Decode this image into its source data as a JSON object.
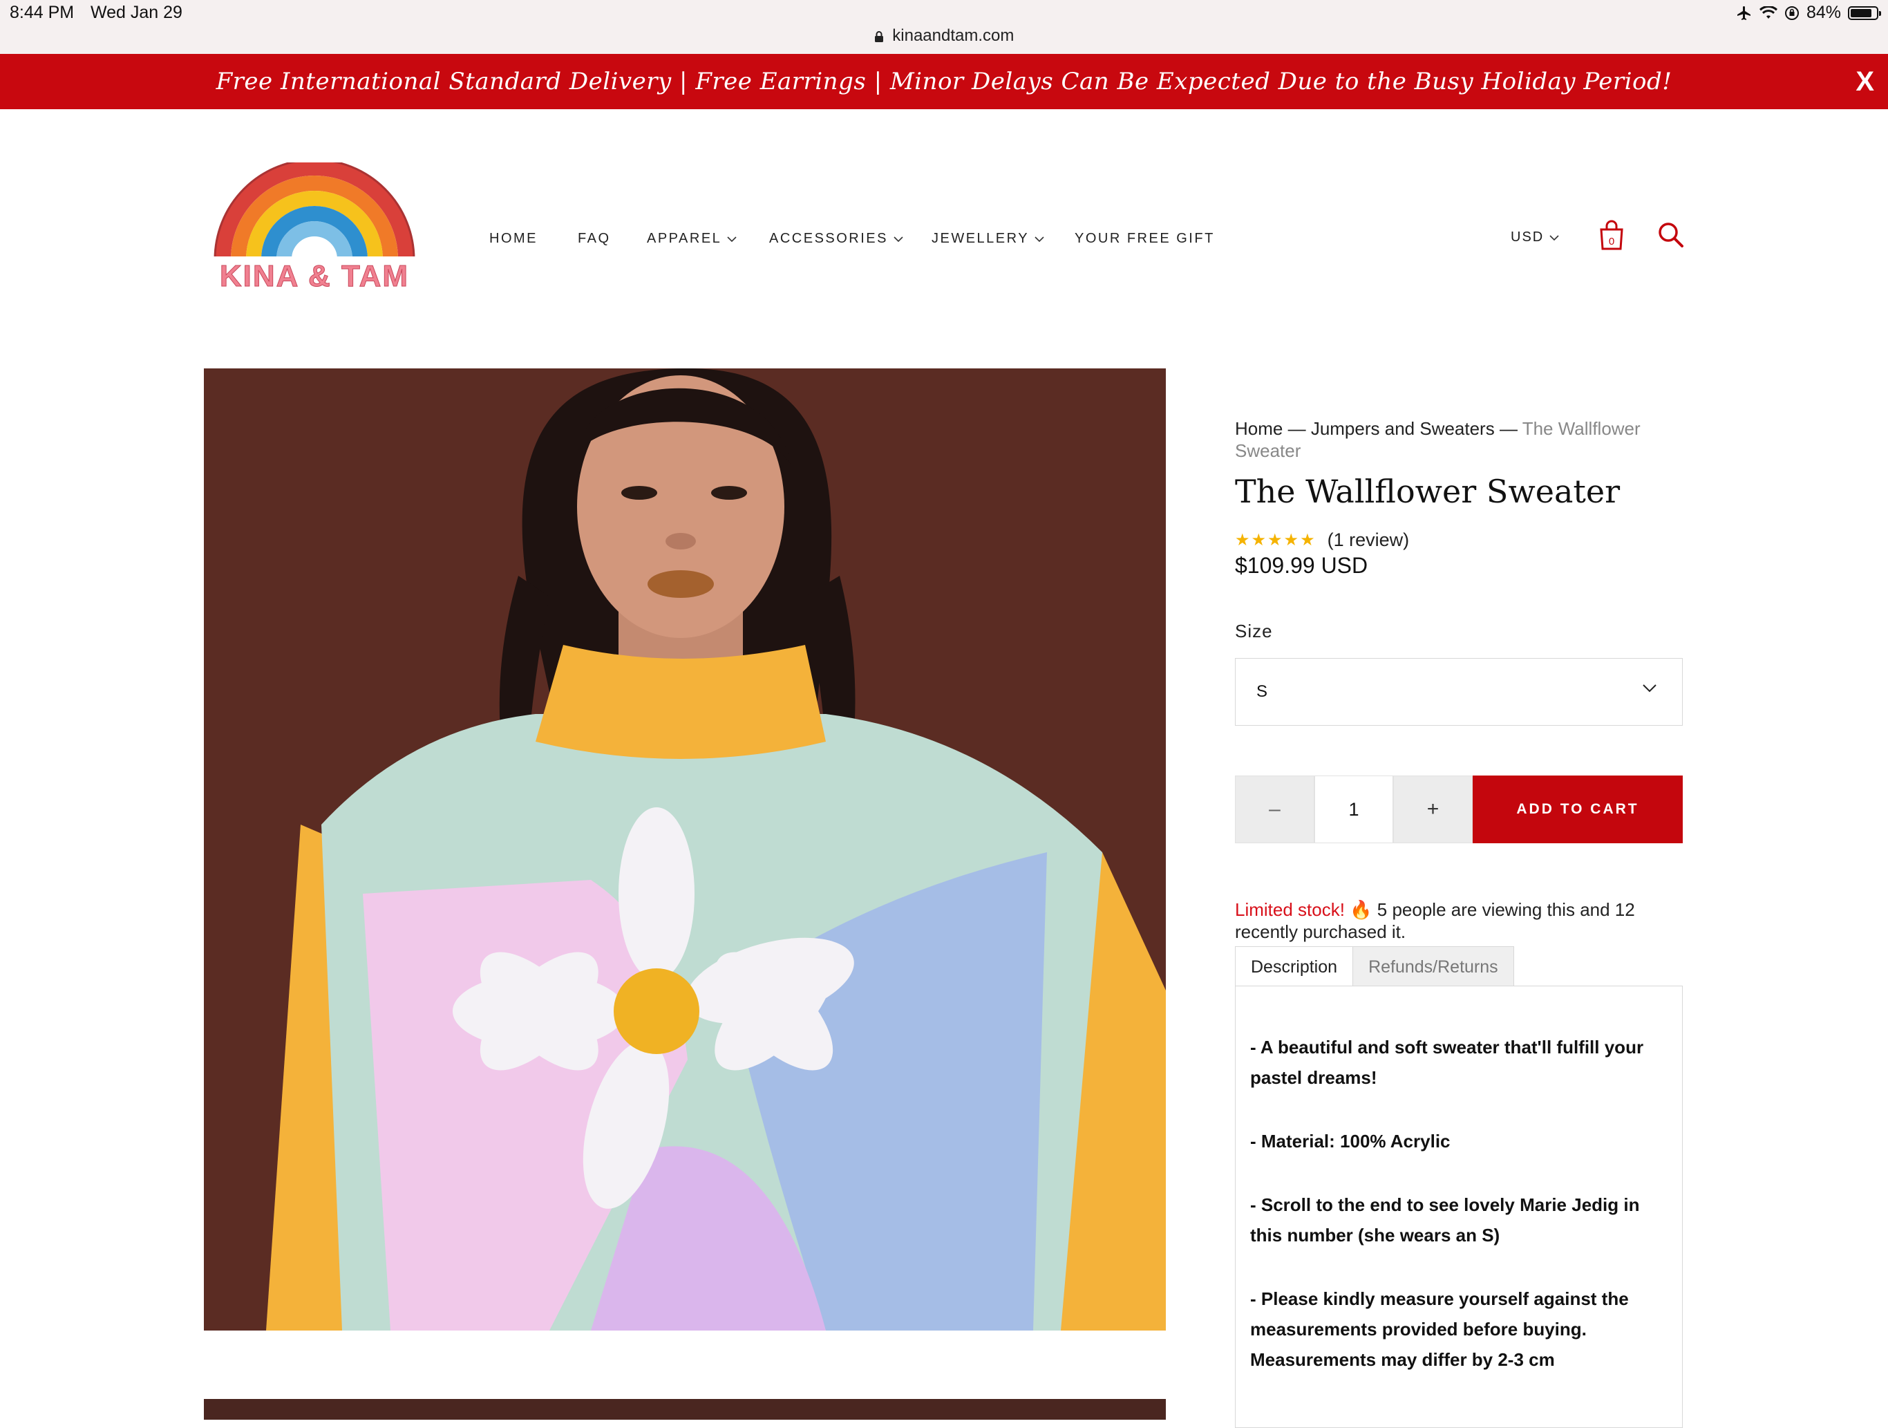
{
  "status_bar": {
    "time": "8:44 PM",
    "date": "Wed Jan 29",
    "battery": "84%",
    "icons": [
      "airplane-icon",
      "wifi-icon",
      "orientation-lock-icon",
      "battery-icon"
    ]
  },
  "browser": {
    "url": "kinaandtam.com"
  },
  "promo": {
    "text": "Free International Standard Delivery | Free Earrings | Minor Delays Can Be Expected Due to the Busy Holiday Period!",
    "close_label": "X",
    "color": "#c8080f"
  },
  "header": {
    "logo_text": "KINA & TAM",
    "nav": [
      {
        "label": "HOME",
        "dropdown": false
      },
      {
        "label": "FAQ",
        "dropdown": false
      },
      {
        "label": "APPAREL",
        "dropdown": true
      },
      {
        "label": "ACCESSORIES",
        "dropdown": true
      },
      {
        "label": "JEWELLERY",
        "dropdown": true
      },
      {
        "label": "YOUR FREE GIFT",
        "dropdown": false
      }
    ],
    "currency": "USD",
    "cart_count": "0",
    "accent_color": "#c4060d"
  },
  "product": {
    "breadcrumb": {
      "home": "Home",
      "sep1": " — ",
      "category": "Jumpers and Sweaters",
      "sep2": " — ",
      "current": "The Wallflower Sweater"
    },
    "title": "The Wallflower Sweater",
    "rating": 5,
    "stars": "★★★★★",
    "review_count": "(1 review)",
    "price": "$109.99 USD",
    "size_label": "Size",
    "size_value": "S",
    "quantity": "1",
    "minus_label": "–",
    "plus_label": "+",
    "add_to_cart": "ADD TO CART",
    "stock_label": "Limited stock!",
    "stock_emoji": "🔥",
    "stock_text": " 5 people are viewing this and 12 recently purchased it.",
    "tabs": [
      "Description",
      "Refunds/Returns"
    ],
    "description": [
      "- A beautiful and soft sweater that'll fulfill your pastel dreams!",
      "- Material: 100% Acrylic",
      "- Scroll to the end to see lovely Marie Jedig in this number (she wears an S)",
      "- Please kindly measure yourself against the measurements provided before buying. Measurements may differ by 2-3 cm"
    ]
  }
}
